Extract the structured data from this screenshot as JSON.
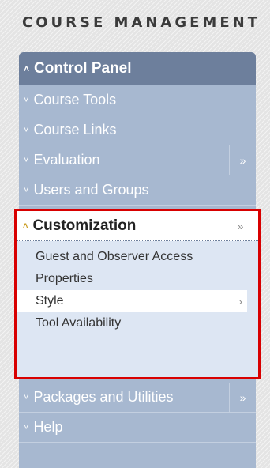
{
  "header": {
    "title": "COURSE MANAGEMENT"
  },
  "panel": {
    "title": "Control Panel",
    "items": [
      {
        "label": "Course Tools",
        "expandable": false
      },
      {
        "label": "Course Links",
        "expandable": false
      },
      {
        "label": "Evaluation",
        "expandable": true
      },
      {
        "label": "Users and Groups",
        "expandable": false
      }
    ],
    "customization": {
      "label": "Customization",
      "subitems": [
        {
          "label": "Guest and Observer Access"
        },
        {
          "label": "Properties"
        },
        {
          "label": "Style"
        },
        {
          "label": "Tool Availability"
        }
      ]
    },
    "lower_items": [
      {
        "label": "Packages and Utilities",
        "expandable": true
      },
      {
        "label": "Help",
        "expandable": false
      }
    ]
  },
  "icons": {
    "collapse": "double-chevron-up-icon",
    "expand": "double-chevron-down-icon",
    "flyout": "double-chevron-right-icon",
    "submenu_arrow": "chevron-right-icon"
  },
  "colors": {
    "panel_bg": "#a7b8d0",
    "panel_header": "#6d7f9c",
    "highlight_border": "#d80000",
    "submenu_bg": "#dde6f3"
  }
}
